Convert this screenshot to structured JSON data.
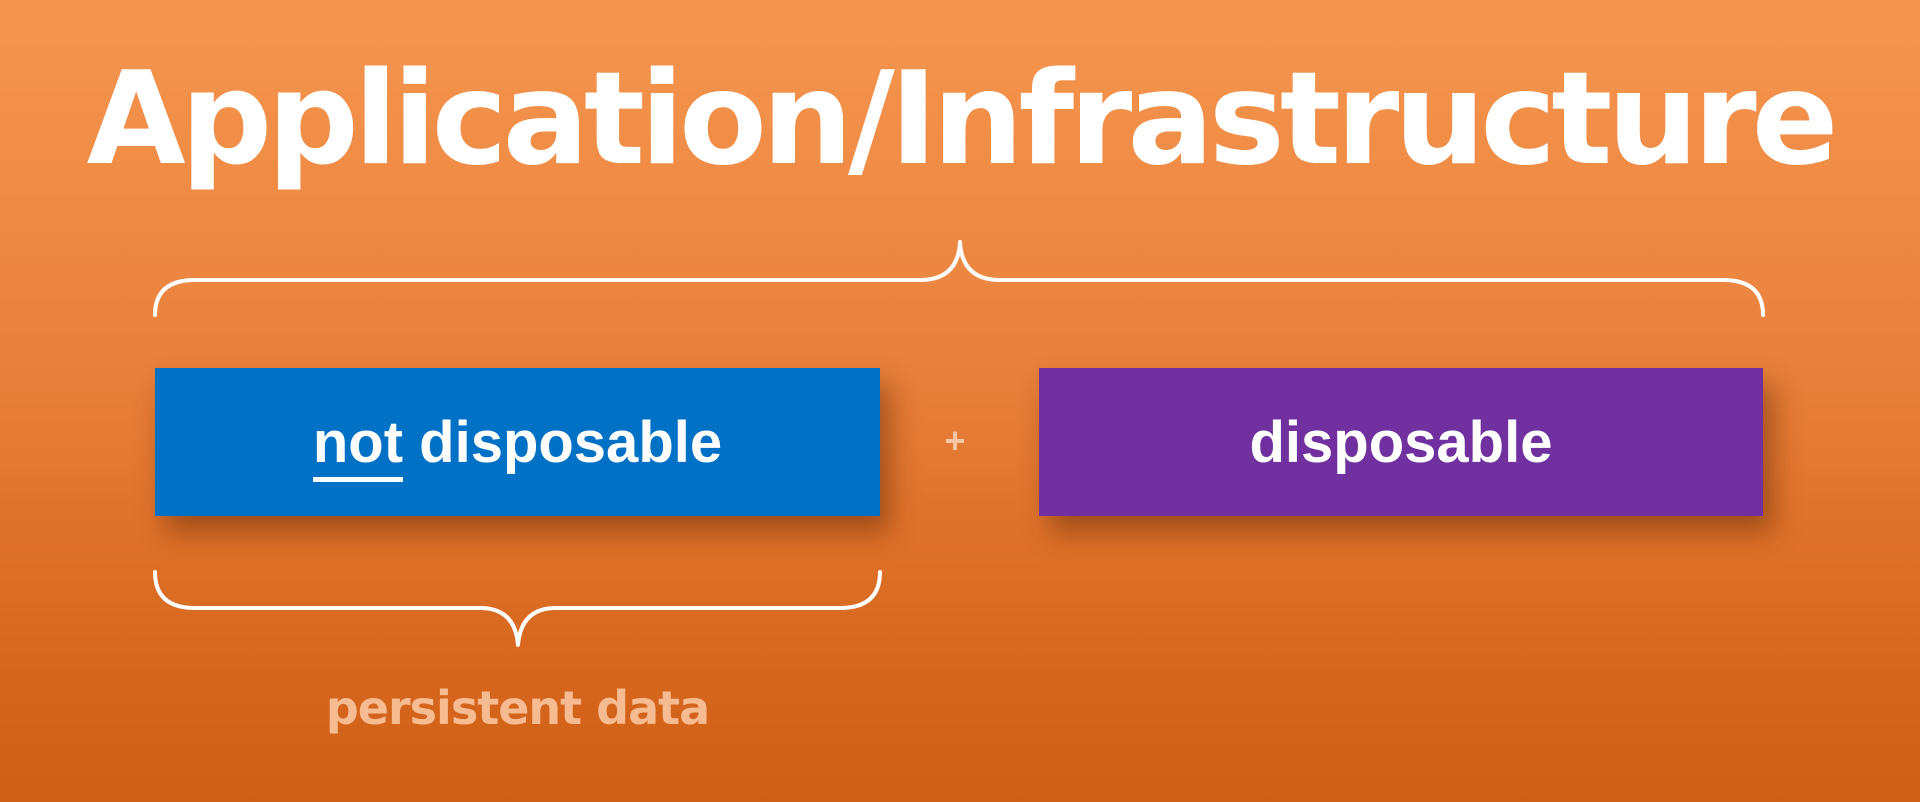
{
  "title": "Application/Infrastructure",
  "boxes": {
    "left": {
      "emphasis": "not",
      "rest": " disposable",
      "color": "#0071c5"
    },
    "right": {
      "label": "disposable",
      "color": "#7030a0"
    }
  },
  "operator": "+",
  "caption": "persistent data",
  "colors": {
    "background_top": "#f5964f",
    "background_bottom": "#d05f16",
    "text": "#ffffff",
    "caption": "#f6bb91"
  }
}
